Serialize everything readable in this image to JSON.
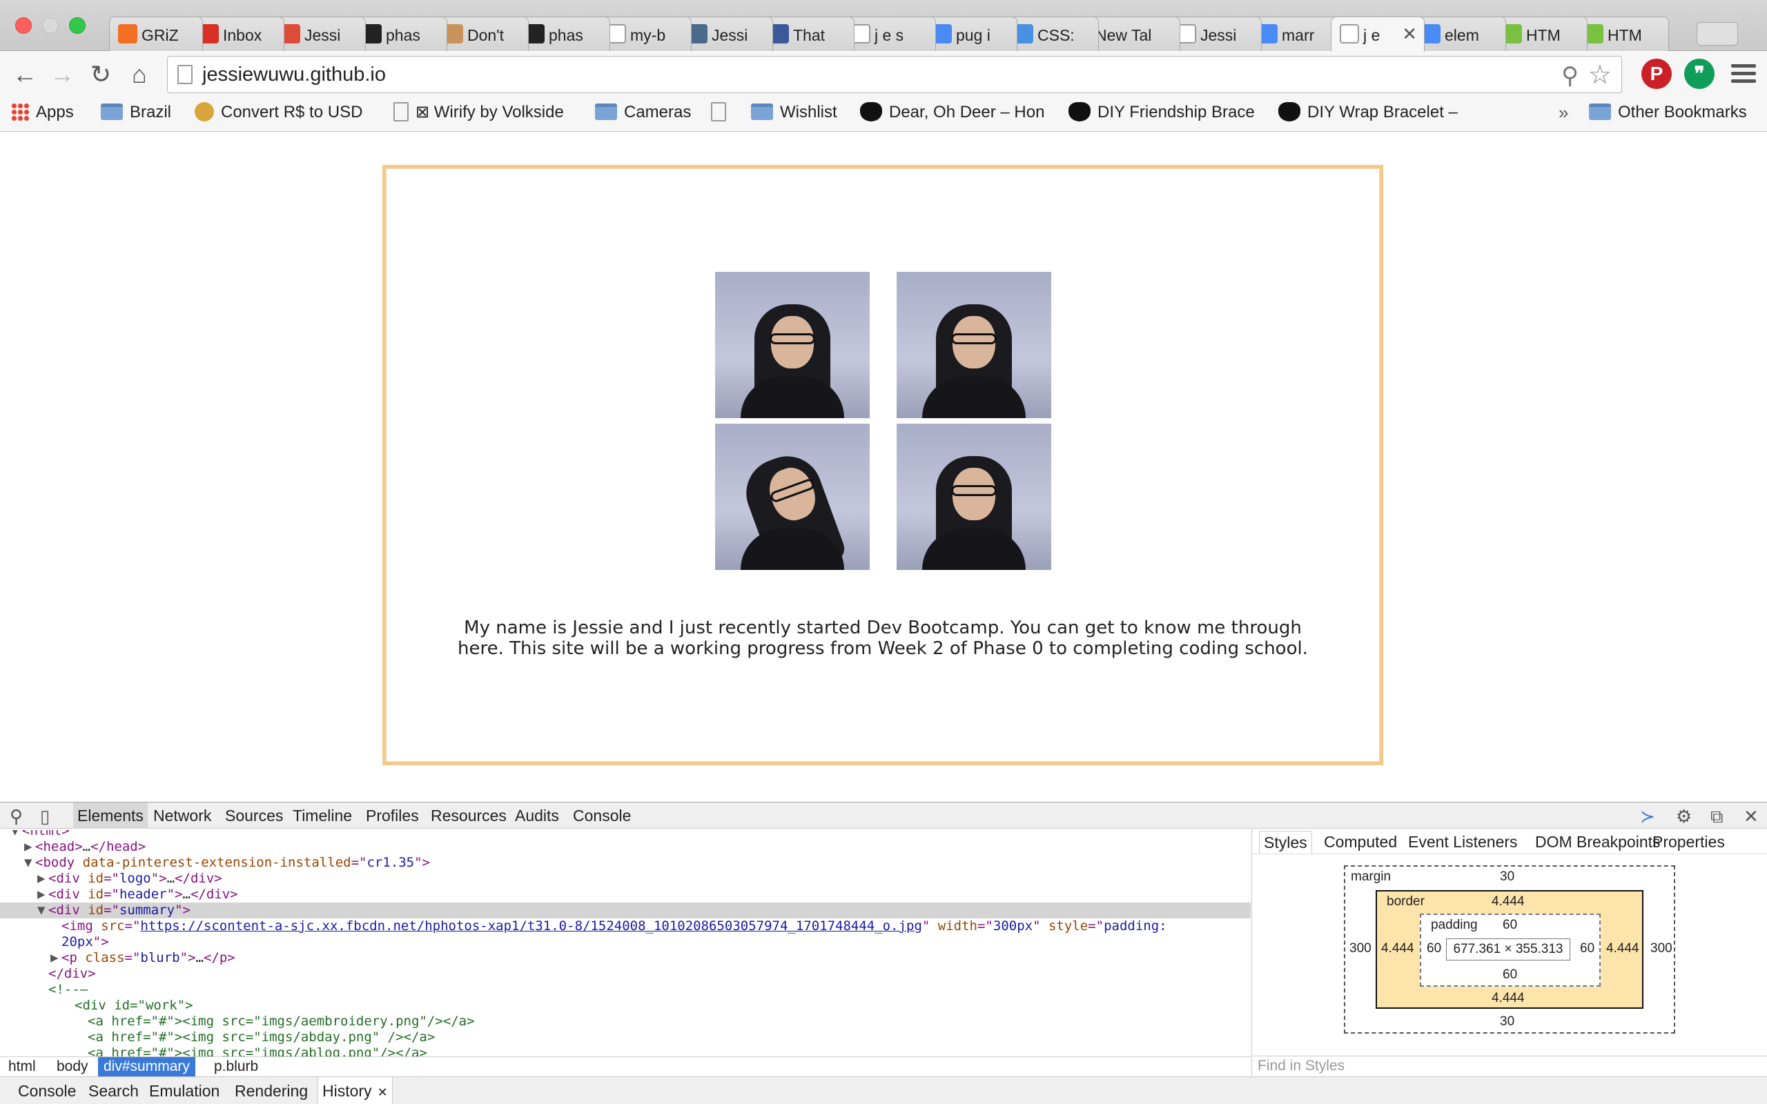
{
  "tabs": [
    {
      "title": "GRiZ",
      "icon": "soundcloud-icon",
      "color": "#f26f23"
    },
    {
      "title": "Inbox",
      "icon": "gmail-icon",
      "color": "#d93025"
    },
    {
      "title": "Jessi",
      "icon": "google-plus-icon",
      "color": "#dd4b39"
    },
    {
      "title": "phas",
      "icon": "github-icon",
      "color": "#222222"
    },
    {
      "title": "Don't",
      "icon": "diamond-icon",
      "color": "#c8935b"
    },
    {
      "title": "phas",
      "icon": "github-icon",
      "color": "#222222"
    },
    {
      "title": "my-b",
      "icon": "page-icon",
      "color": "#ffffff"
    },
    {
      "title": "Jessi",
      "icon": "app-icon",
      "color": "#4a6a8a"
    },
    {
      "title": "That",
      "icon": "facebook-icon",
      "color": "#3b5998"
    },
    {
      "title": "j e s",
      "icon": "page-icon",
      "color": "#ffffff"
    },
    {
      "title": "pug i",
      "icon": "google-search-icon",
      "color": "#4a8af4"
    },
    {
      "title": "CSS:",
      "icon": "w3schools-icon",
      "color": "#4a90e2"
    },
    {
      "title": "New Tal",
      "icon": "",
      "color": ""
    },
    {
      "title": "Jessi",
      "icon": "page-icon",
      "color": "#ffffff"
    },
    {
      "title": "marr",
      "icon": "google-search-icon",
      "color": "#4a8af4"
    },
    {
      "title": "j e",
      "icon": "page-icon",
      "color": "#ffffff",
      "active": true
    },
    {
      "title": "elem",
      "icon": "google-search-icon",
      "color": "#4a8af4"
    },
    {
      "title": "HTM",
      "icon": "html-icon",
      "color": "#7ac142"
    },
    {
      "title": "HTM",
      "icon": "html-icon",
      "color": "#7ac142"
    }
  ],
  "active_tab_close": "✕",
  "toolbar": {
    "url": "jessiewuwu.github.io"
  },
  "bookmarks": [
    {
      "label": "Apps",
      "icon": "apps-icon"
    },
    {
      "label": "Brazil",
      "icon": "folder-icon"
    },
    {
      "label": "Convert R$ to USD",
      "icon": "python-icon"
    },
    {
      "label": "⊠ Wirify by Volkside",
      "icon": "page-icon"
    },
    {
      "label": "Cameras",
      "icon": "folder-icon"
    },
    {
      "label": "",
      "icon": "person-icon"
    },
    {
      "label": "Wishlist",
      "icon": "folder-icon"
    },
    {
      "label": "Dear, Oh Deer – Hon",
      "icon": "deer-icon"
    },
    {
      "label": "DIY Friendship Brace",
      "icon": "deer-icon"
    },
    {
      "label": "DIY Wrap Bracelet –",
      "icon": "deer-icon"
    }
  ],
  "bookmarks_overflow": "»",
  "other_bookmarks": "Other Bookmarks",
  "page": {
    "blurb": "My name is Jessie and I just recently started Dev Bootcamp. You can get to know me through here. This site will be a working progress from Week 2 of Phase 0 to completing coding school."
  },
  "devtools": {
    "tabs": [
      "Elements",
      "Network",
      "Sources",
      "Timeline",
      "Profiles",
      "Resources",
      "Audits",
      "Console"
    ],
    "dom_lines": [
      {
        "indent": 0,
        "tri": "▼",
        "parts": [
          [
            "tag",
            "<html>"
          ]
        ],
        "cut": true
      },
      {
        "indent": 1,
        "tri": "▶",
        "parts": [
          [
            "tag",
            "<head>"
          ],
          [
            "plain",
            "…"
          ],
          [
            "tag",
            "</head>"
          ]
        ]
      },
      {
        "indent": 1,
        "tri": "▼",
        "parts": [
          [
            "tag",
            "<body "
          ],
          [
            "attr",
            "data-pinterest-extension-installed"
          ],
          [
            "tag",
            "=\""
          ],
          [
            "val",
            "cr1.35"
          ],
          [
            "tag",
            "\">"
          ]
        ]
      },
      {
        "indent": 2,
        "tri": "▶",
        "parts": [
          [
            "tag",
            "<div "
          ],
          [
            "attr",
            "id"
          ],
          [
            "tag",
            "=\""
          ],
          [
            "val",
            "logo"
          ],
          [
            "tag",
            "\">"
          ],
          [
            "plain",
            "…"
          ],
          [
            "tag",
            "</div>"
          ]
        ]
      },
      {
        "indent": 2,
        "tri": "▶",
        "parts": [
          [
            "tag",
            "<div "
          ],
          [
            "attr",
            "id"
          ],
          [
            "tag",
            "=\""
          ],
          [
            "val",
            "header"
          ],
          [
            "tag",
            "\">"
          ],
          [
            "plain",
            "…"
          ],
          [
            "tag",
            "</div>"
          ]
        ]
      },
      {
        "indent": 2,
        "tri": "▼",
        "sel": true,
        "parts": [
          [
            "tag",
            "<div "
          ],
          [
            "attr",
            "id"
          ],
          [
            "tag",
            "=\""
          ],
          [
            "val",
            "summary"
          ],
          [
            "tag",
            "\">"
          ]
        ]
      },
      {
        "indent": 3,
        "tri": "",
        "parts": [
          [
            "tag",
            "<img "
          ],
          [
            "attr",
            "src"
          ],
          [
            "tag",
            "=\""
          ],
          [
            "lnk",
            "https://scontent-a-sjc.xx.fbcdn.net/hphotos-xap1/t31.0-8/1524008_10102086503057974_1701748444_o.jpg"
          ],
          [
            "tag",
            "\" "
          ],
          [
            "attr",
            "width"
          ],
          [
            "tag",
            "=\""
          ],
          [
            "val",
            "300px"
          ],
          [
            "tag",
            "\" "
          ],
          [
            "attr",
            "style"
          ],
          [
            "tag",
            "=\""
          ],
          [
            "val",
            "padding:"
          ]
        ]
      },
      {
        "indent": 3,
        "tri": "",
        "parts": [
          [
            "val",
            "20px"
          ],
          [
            "tag",
            "\">"
          ]
        ]
      },
      {
        "indent": 3,
        "tri": "▶",
        "parts": [
          [
            "tag",
            "<p "
          ],
          [
            "attr",
            "class"
          ],
          [
            "tag",
            "=\""
          ],
          [
            "val",
            "blurb"
          ],
          [
            "tag",
            "\">"
          ],
          [
            "plain",
            "…"
          ],
          [
            "tag",
            "</p>"
          ]
        ]
      },
      {
        "indent": 2,
        "tri": "",
        "parts": [
          [
            "tag",
            "</div>"
          ]
        ]
      },
      {
        "indent": 2,
        "tri": "",
        "parts": [
          [
            "cmt",
            "<!--–"
          ]
        ]
      },
      {
        "indent": 4,
        "tri": "",
        "parts": [
          [
            "cmt",
            "<div id=\"work\">"
          ]
        ]
      },
      {
        "indent": 5,
        "tri": "",
        "parts": [
          [
            "cmt",
            "<a href=\"#\"><img src=\"imgs/aembroidery.png\"/></a>"
          ]
        ]
      },
      {
        "indent": 5,
        "tri": "",
        "parts": [
          [
            "cmt",
            "<a href=\"#\"><img src=\"imgs/abday.png\" /></a>"
          ]
        ]
      },
      {
        "indent": 5,
        "tri": "",
        "parts": [
          [
            "cmt",
            "<a href=\"#\"><img src=\"imgs/ablog.png\"/></a>"
          ]
        ],
        "cut": true
      }
    ],
    "breadcrumbs": [
      {
        "label": "html"
      },
      {
        "label": "body"
      },
      {
        "label": "div#summary",
        "selected": true
      },
      {
        "label": "p.blurb"
      }
    ],
    "sidebar_tabs": [
      "Styles",
      "Computed",
      "Event Listeners",
      "DOM Breakpoints",
      "Properties"
    ],
    "box_model": {
      "margin_label": "margin",
      "margin_top": "30",
      "margin_bottom": "30",
      "margin_left": "300",
      "margin_right": "300",
      "border_label": "border",
      "border_top": "4.444",
      "border_bottom": "4.444",
      "border_left": "4.444",
      "border_right": "4.444",
      "padding_label": "padding",
      "padding_top": "60",
      "padding_bottom": "60",
      "padding_left": "60",
      "padding_right": "60",
      "content": "677.361 × 355.313"
    },
    "find_placeholder": "Find in Styles",
    "drawer_tabs": [
      "Console",
      "Search",
      "Emulation",
      "Rendering",
      "History"
    ],
    "drawer_close": "✕"
  },
  "colors": {
    "summary_border": "#f5c98a",
    "selected_crumb": "#3879d9",
    "box_border_fill": "#fce4ab"
  }
}
